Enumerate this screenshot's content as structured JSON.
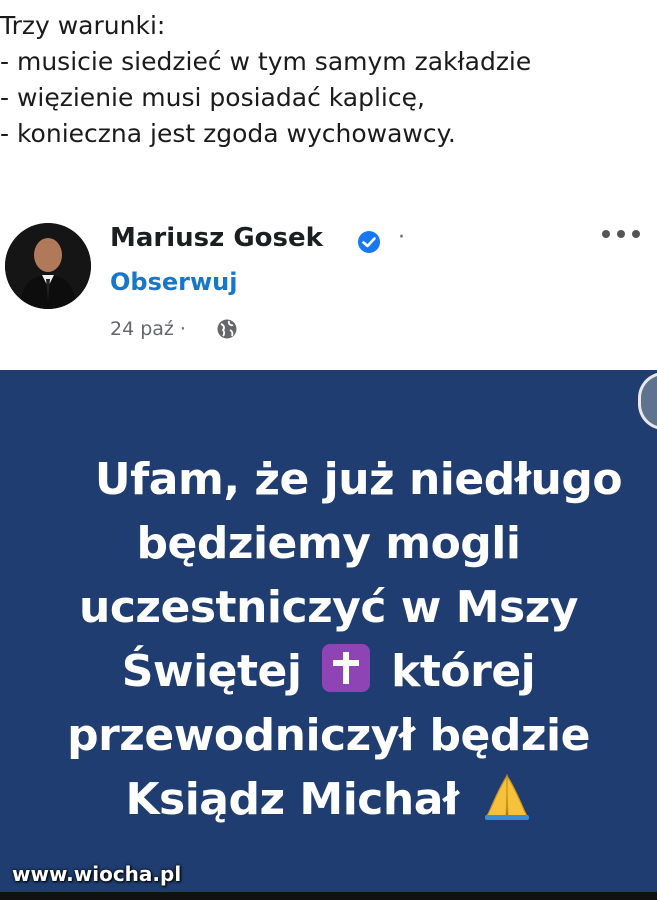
{
  "caption": {
    "lines": [
      "Trzy warunki:",
      "- musicie siedzieć w tym samym zakładzie",
      "- więzienie musi posiadać kaplicę,",
      "- konieczna jest zgoda wychowawcy."
    ]
  },
  "post": {
    "author": "Mariusz Gosek",
    "separator": "·",
    "follow_label": "Obserwuj",
    "date": "24 paź ·",
    "icons": {
      "verified": "verified-badge-icon",
      "more": "more-options-icon",
      "audience": "globe-icon"
    },
    "colors": {
      "follow": "#1877c9",
      "verified": "#1877f2",
      "image_bg": "#1f3d70"
    },
    "image_text": {
      "line1": "Ufam, że już niedługo",
      "line2": "będziemy mogli",
      "line3": "uczestniczyć w Mszy",
      "line4_a": "Świętej",
      "line4_b": "której",
      "line5": "przewodniczył będzie",
      "line6": "Ksiądz Michał"
    }
  },
  "watermark": "www.wiocha.pl"
}
